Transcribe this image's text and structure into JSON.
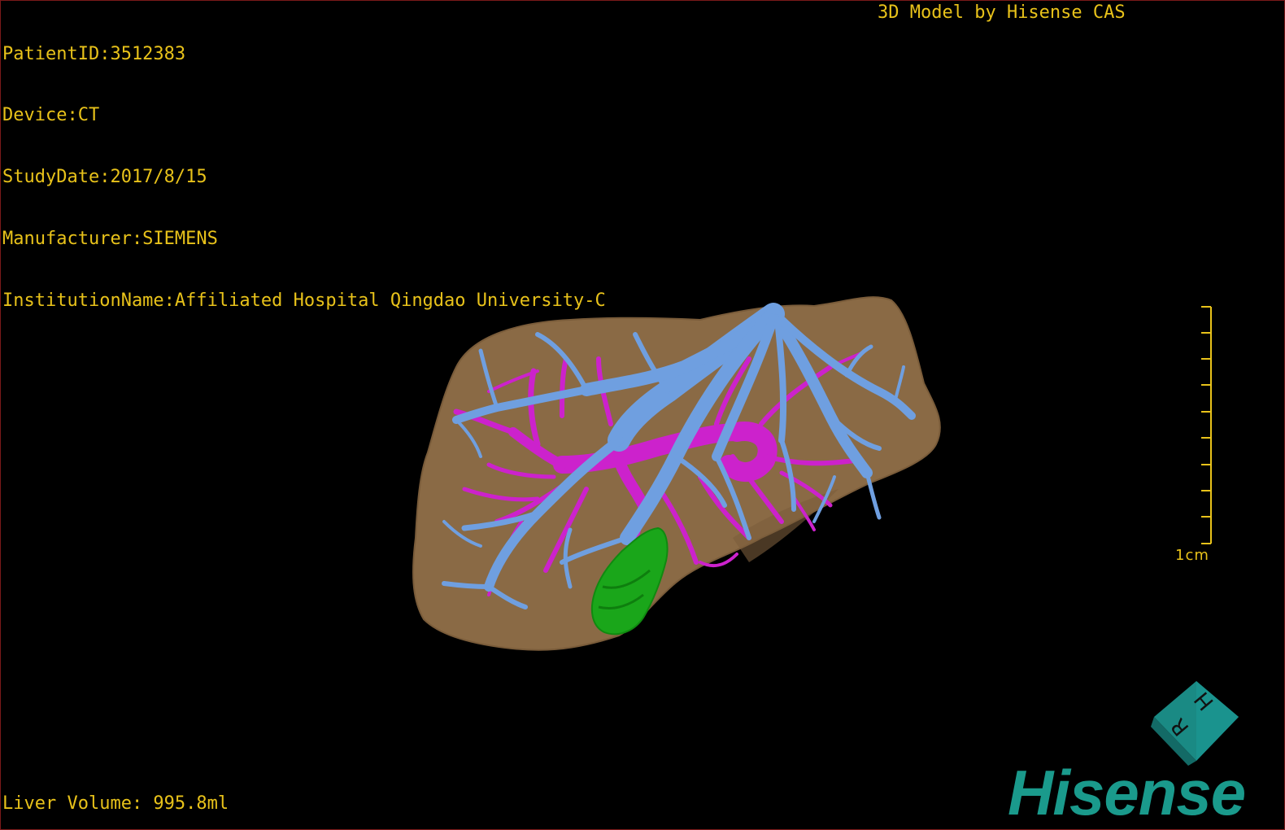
{
  "overlay": {
    "patient_id": "PatientID:3512383",
    "device": "Device:CT",
    "study_date": "StudyDate:2017/8/15",
    "manufacturer": "Manufacturer:SIEMENS",
    "institution": "InstitutionName:Affiliated Hospital Qingdao University-C",
    "credit": "3D Model by Hisense CAS",
    "liver_volume": "Liver Volume: 995.8ml"
  },
  "scale_bar": {
    "label": "1cm"
  },
  "orientation_cube": {
    "face_letter_1": "H",
    "face_letter_2": "R"
  },
  "brand": {
    "name": "Hisense"
  },
  "colors": {
    "background": "#000000",
    "overlay_text": "#e8c21a",
    "liver": "#8a6a45",
    "hepatic_vein": "#6f9fe0",
    "portal_vein": "#cc22cc",
    "gallbladder": "#1aa61a",
    "brand": "#1a9a8c"
  }
}
